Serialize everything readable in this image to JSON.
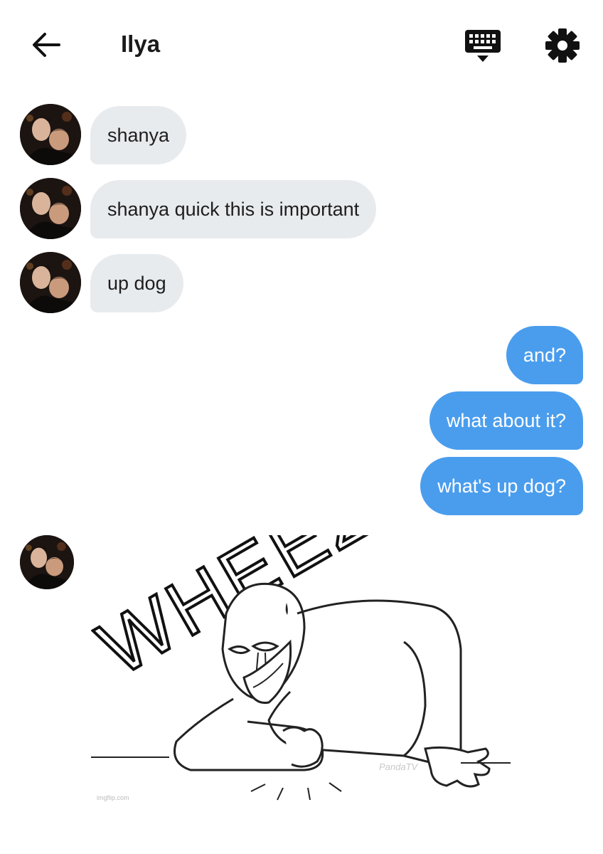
{
  "header": {
    "title": "Ilya"
  },
  "messages": {
    "incoming": [
      "shanya",
      "shanya quick this is important",
      "up dog"
    ],
    "outgoing": [
      "and?",
      "what about it?",
      "what's up dog?"
    ]
  },
  "gif": {
    "caption_text": "WHEEZE",
    "watermark_left": "imgflip.com",
    "watermark_right": "PandaTV"
  },
  "colors": {
    "incoming_bubble": "#e8ebee",
    "outgoing_bubble": "#4a9ded",
    "outgoing_text": "#ffffff"
  }
}
